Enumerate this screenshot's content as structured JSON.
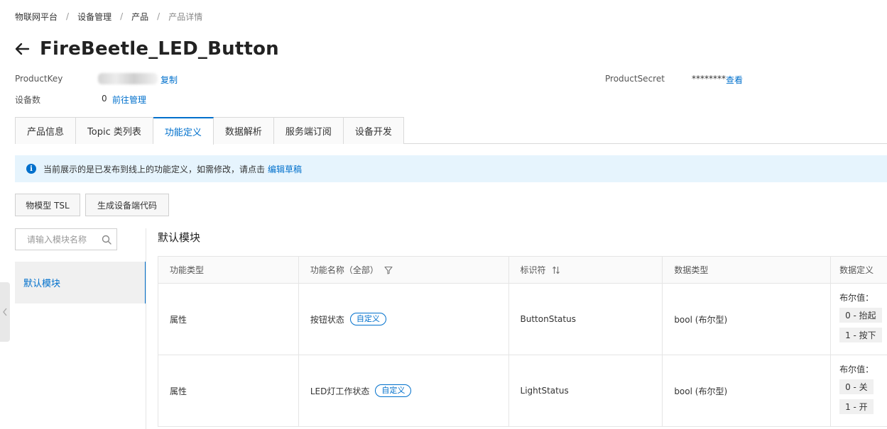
{
  "breadcrumb": [
    "物联网平台",
    "设备管理",
    "产品",
    "产品详情"
  ],
  "page": {
    "title": "FireBeetle_LED_Button"
  },
  "meta": {
    "product_key_label": "ProductKey",
    "product_key_value": "",
    "copy_link": "复制",
    "device_count_label": "设备数",
    "device_count_value": "0",
    "manage_link": "前往管理",
    "product_secret_label": "ProductSecret",
    "product_secret_value": "********",
    "view_link": "查看"
  },
  "tabs": [
    "产品信息",
    "Topic 类列表",
    "功能定义",
    "数据解析",
    "服务端订阅",
    "设备开发"
  ],
  "active_tab": "功能定义",
  "info": {
    "text": "当前展示的是已发布到线上的功能定义，如需修改，请点击",
    "link": "编辑草稿"
  },
  "buttons": {
    "tsl": "物模型 TSL",
    "gen_code": "生成设备端代码"
  },
  "search": {
    "placeholder": "请输入模块名称"
  },
  "modules": [
    "默认模块"
  ],
  "section_title": "默认模块",
  "table": {
    "headers": [
      "功能类型",
      "功能名称（全部）",
      "标识符",
      "数据类型",
      "数据定义"
    ],
    "rows": [
      {
        "type": "属性",
        "name": "按钮状态",
        "tag": "自定义",
        "identifier": "ButtonStatus",
        "data_type": "bool (布尔型)",
        "def_label": "布尔值：",
        "defs": [
          "0 - 抬起",
          "1 - 按下"
        ]
      },
      {
        "type": "属性",
        "name": "LED灯工作状态",
        "tag": "自定义",
        "identifier": "LightStatus",
        "data_type": "bool (布尔型)",
        "def_label": "布尔值：",
        "defs": [
          "0 - 关",
          "1 - 开"
        ]
      }
    ]
  },
  "colors": {
    "accent": "#0070cc",
    "info_bg": "#e6f4fd"
  },
  "icons": {
    "back": "arrow-left-icon",
    "info": "info-circle-icon",
    "search": "search-icon",
    "filter": "filter-icon",
    "sort": "sort-icon",
    "collapse": "chevron-left-icon"
  }
}
